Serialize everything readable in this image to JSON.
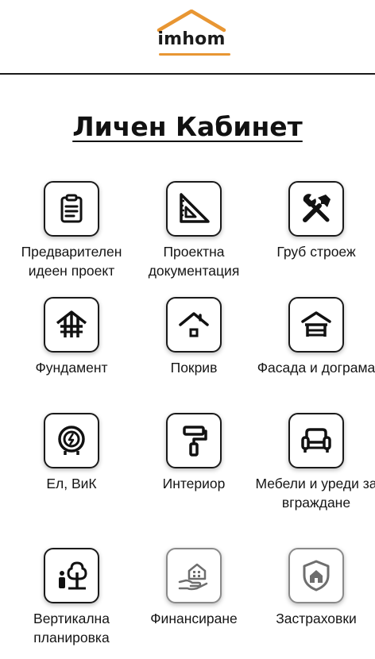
{
  "header": {
    "logo_text": "imhom",
    "brand_color": "#e89633"
  },
  "page": {
    "title": "Личен Кабинет"
  },
  "tiles": [
    {
      "label": "Предварителен идеен проект",
      "icon": "clipboard-icon"
    },
    {
      "label": "Проектна документация",
      "icon": "set-square-icon"
    },
    {
      "label": "Груб строеж",
      "icon": "tools-icon"
    },
    {
      "label": "Фундамент",
      "icon": "foundation-icon"
    },
    {
      "label": "Покрив",
      "icon": "roof-icon"
    },
    {
      "label": "Фасада и дограма",
      "icon": "facade-icon"
    },
    {
      "label": "Ел, ВиК",
      "icon": "meter-icon"
    },
    {
      "label": "Интериор",
      "icon": "paint-roller-icon"
    },
    {
      "label": "Мебели и уреди за вграждане",
      "icon": "armchair-icon"
    },
    {
      "label": "Вертикална планировка",
      "icon": "tree-person-icon"
    },
    {
      "label": "Финансиране",
      "icon": "hand-house-icon"
    },
    {
      "label": "Застраховки",
      "icon": "shield-house-icon"
    }
  ]
}
